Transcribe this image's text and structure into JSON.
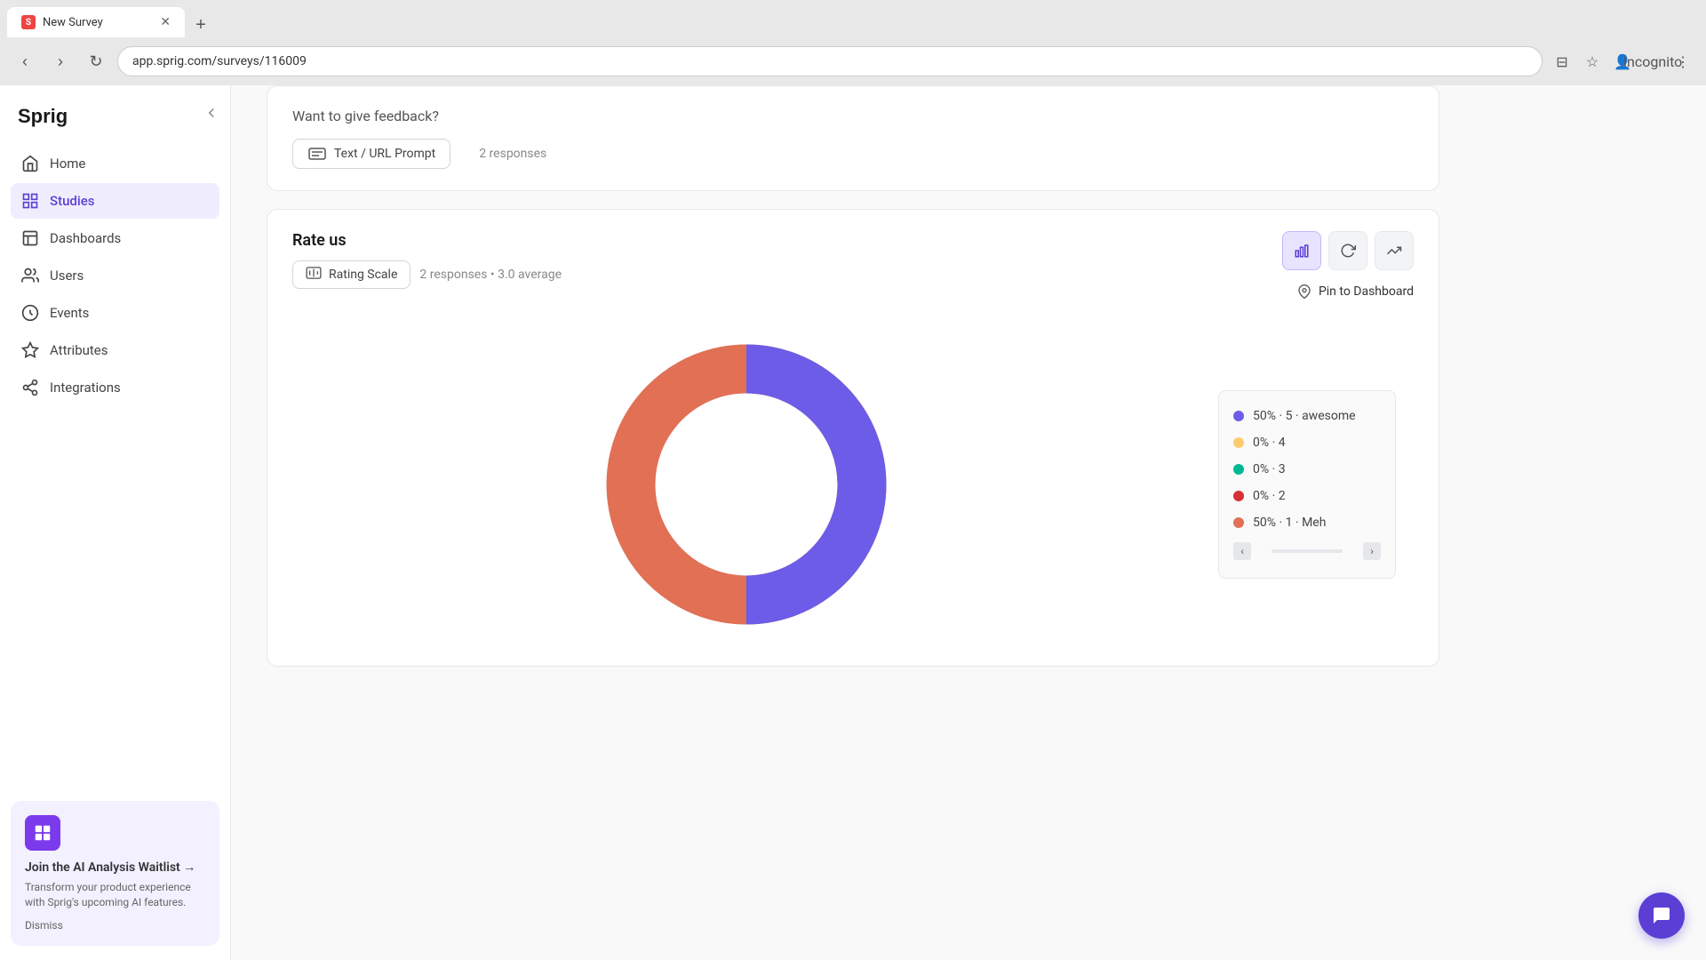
{
  "browser": {
    "tab_label": "New Survey",
    "tab_favicon": "S",
    "url": "app.sprig.com/surveys/116009",
    "new_tab_icon": "+"
  },
  "sidebar": {
    "logo_text": "Sprig",
    "nav_items": [
      {
        "id": "home",
        "label": "Home",
        "active": false
      },
      {
        "id": "studies",
        "label": "Studies",
        "active": true
      },
      {
        "id": "dashboards",
        "label": "Dashboards",
        "active": false
      },
      {
        "id": "users",
        "label": "Users",
        "active": false
      },
      {
        "id": "events",
        "label": "Events",
        "active": false
      },
      {
        "id": "attributes",
        "label": "Attributes",
        "active": false
      },
      {
        "id": "integrations",
        "label": "Integrations",
        "active": false
      }
    ],
    "ai_banner": {
      "title": "Join the AI Analysis Waitlist →",
      "description": "Transform your product experience with Sprig's upcoming AI features.",
      "dismiss_label": "Dismiss"
    }
  },
  "top_card": {
    "question": "Want to give feedback?",
    "badge_label": "Text / URL Prompt",
    "responses_text": "2 responses"
  },
  "rating_card": {
    "title": "Rate us",
    "badge_label": "Rating Scale",
    "responses_text": "2 responses • 3.0 average",
    "pin_label": "Pin to Dashboard",
    "chart": {
      "segments": [
        {
          "label": "50% · 5 · awesome",
          "color": "#6c5ce7",
          "pct": 50
        },
        {
          "label": "0% · 4",
          "color": "#fdcb6e",
          "pct": 0
        },
        {
          "label": "0% · 3",
          "color": "#00b894",
          "pct": 0
        },
        {
          "label": "0% · 2",
          "color": "#d63031",
          "pct": 0
        },
        {
          "label": "50% · 1 · Meh",
          "color": "#e17055",
          "pct": 50
        }
      ]
    }
  },
  "icons": {
    "bar_chart": "▦",
    "refresh": "↻",
    "trend": "↗",
    "pin": "📌",
    "chat": "💬"
  }
}
